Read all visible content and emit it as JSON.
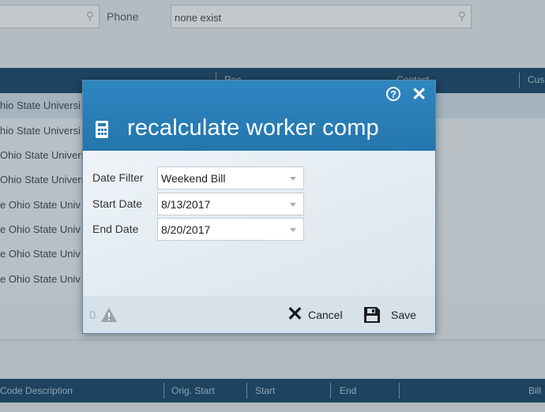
{
  "background": {
    "phone_label": "Phone",
    "phone_value": "none exist",
    "grid_headers": [
      "Rec",
      "Contact",
      "Cus"
    ],
    "rows": [
      "hio State Universi",
      "hio State Universi",
      "Ohio State Univers",
      "Ohio State Univers",
      "e Ohio State Univ",
      "e Ohio State Univ",
      "e Ohio State Univ",
      "e Ohio State Univ"
    ],
    "bottom_headers": [
      "Code Description",
      "Orig. Start",
      "Start",
      "End",
      "Bill"
    ]
  },
  "dialog": {
    "title": "recalculate worker comp",
    "fields": [
      {
        "label": "Date Filter",
        "value": "Weekend Bill"
      },
      {
        "label": "Start Date",
        "value": "8/13/2017"
      },
      {
        "label": "End Date",
        "value": "8/20/2017"
      }
    ],
    "error_count": "0",
    "cancel_label": "Cancel",
    "save_label": "Save",
    "icons": {
      "help": "question-circle",
      "close": "close-x",
      "title": "calculator",
      "warning": "warning-triangle",
      "cancel": "x",
      "save": "floppy-disk"
    }
  },
  "colors": {
    "header_blue": "#2a7db5",
    "grid_header_navy": "#1d4360",
    "footer": "#d6e1ea"
  }
}
